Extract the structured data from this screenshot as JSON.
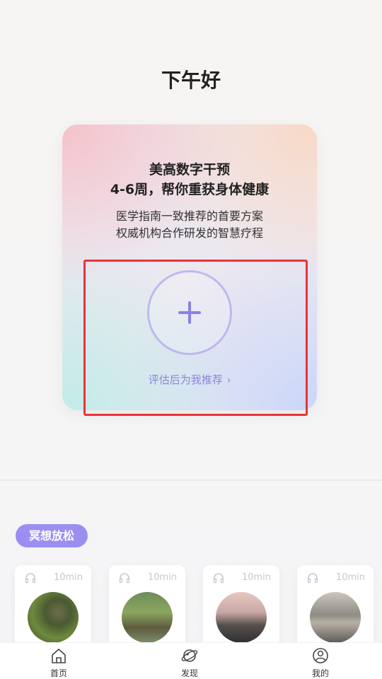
{
  "greeting": "下午好",
  "hero": {
    "title_line1": "美高数字干预",
    "title_line2": "4-6周，帮你重获身体健康",
    "sub_line1": "医学指南一致推荐的首要方案",
    "sub_line2": "权威机构合作研发的智慧疗程",
    "add_icon": "plus-icon",
    "assess_label": "评估后为我推荐",
    "assess_chevron": "›"
  },
  "section": {
    "label": "冥想放松"
  },
  "meditation_cards": [
    {
      "duration": "10min",
      "icon": "headphones-icon"
    },
    {
      "duration": "10min",
      "icon": "headphones-icon"
    },
    {
      "duration": "10min",
      "icon": "headphones-icon"
    },
    {
      "duration": "10min",
      "icon": "headphones-icon"
    }
  ],
  "tab_bar": {
    "items": [
      {
        "label": "首页",
        "icon": "home-icon"
      },
      {
        "label": "发现",
        "icon": "planet-icon"
      },
      {
        "label": "我的",
        "icon": "user-icon"
      }
    ]
  },
  "colors": {
    "accent": "#9a8ff0",
    "plus": "#8c7fe6",
    "link": "#8d86d8",
    "highlight": "#e8333a"
  }
}
